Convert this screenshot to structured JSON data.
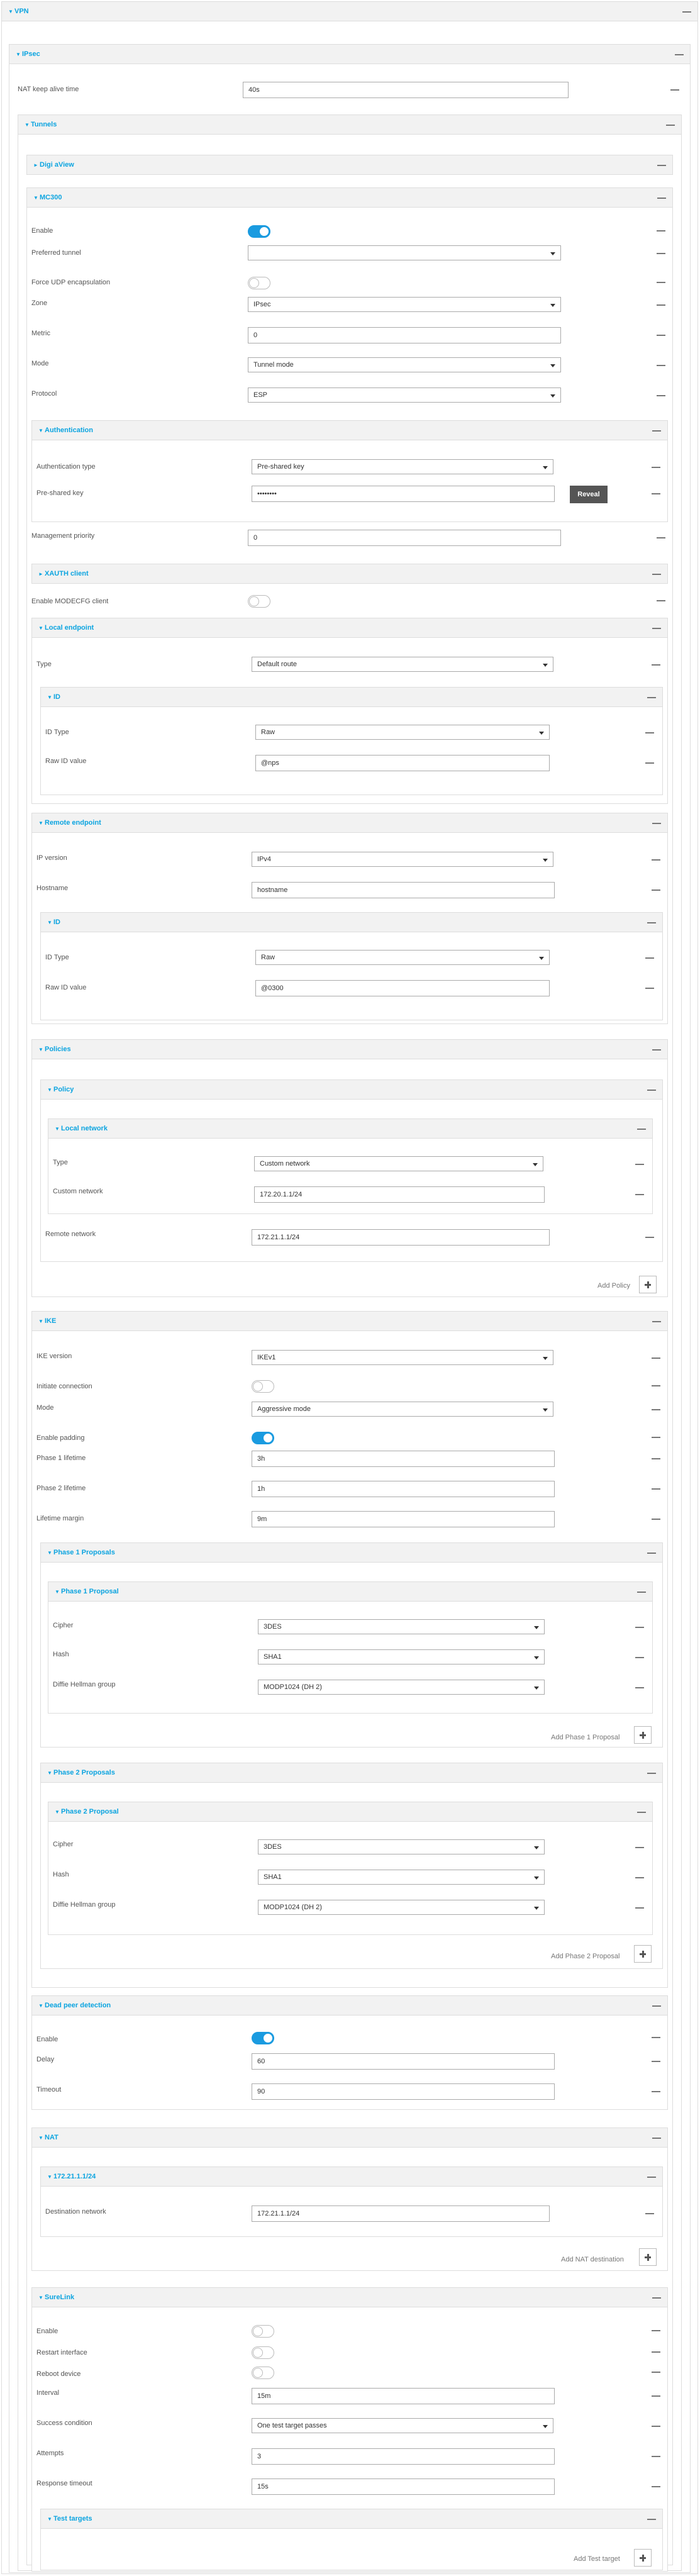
{
  "vpn": {
    "title": "VPN"
  },
  "ipsec": {
    "title": "IPsec",
    "nat_keepalive_label": "NAT keep alive time",
    "nat_keepalive_value": "40s"
  },
  "tunnels": {
    "title": "Tunnels",
    "digi_aview": "Digi aView",
    "tunnel_name": "MC300"
  },
  "tunnel": {
    "enable": "Enable",
    "preferred_tunnel": "Preferred tunnel",
    "preferred_tunnel_value": "",
    "force_udp": "Force UDP encapsulation",
    "zone": "Zone",
    "zone_value": "IPsec",
    "metric": "Metric",
    "metric_value": "0",
    "mode": "Mode",
    "mode_value": "Tunnel mode",
    "protocol": "Protocol",
    "protocol_value": "ESP"
  },
  "auth": {
    "title": "Authentication",
    "type_label": "Authentication type",
    "type_value": "Pre-shared key",
    "psk_label": "Pre-shared key",
    "psk_value": "••••••••",
    "reveal": "Reveal"
  },
  "mgmt_priority": {
    "label": "Management priority",
    "value": "0"
  },
  "xauth": {
    "title": "XAUTH client"
  },
  "modecfg": {
    "label": "Enable MODECFG client"
  },
  "local_endpoint": {
    "title": "Local endpoint",
    "type_label": "Type",
    "type_value": "Default route",
    "id_title": "ID",
    "id_type_label": "ID Type",
    "id_type_value": "Raw",
    "raw_id_label": "Raw ID value",
    "raw_id_value": "@nps"
  },
  "remote_endpoint": {
    "title": "Remote endpoint",
    "ip_version_label": "IP version",
    "ip_version_value": "IPv4",
    "hostname_label": "Hostname",
    "hostname_value": "hostname",
    "id_title": "ID",
    "id_type_label": "ID Type",
    "id_type_value": "Raw",
    "raw_id_label": "Raw ID value",
    "raw_id_value": "@0300"
  },
  "policies": {
    "title": "Policies",
    "policy_title": "Policy",
    "local_network_title": "Local network",
    "type_label": "Type",
    "type_value": "Custom network",
    "custom_network_label": "Custom network",
    "custom_network_value": "172.20.1.1/24",
    "remote_network_label": "Remote network",
    "remote_network_value": "172.21.1.1/24",
    "add": "Add Policy"
  },
  "ike": {
    "title": "IKE",
    "version_label": "IKE version",
    "version_value": "IKEv1",
    "initiate_label": "Initiate connection",
    "mode_label": "Mode",
    "mode_value": "Aggressive mode",
    "padding_label": "Enable padding",
    "p1life_label": "Phase 1 lifetime",
    "p1life_value": "3h",
    "p2life_label": "Phase 2 lifetime",
    "p2life_value": "1h",
    "margin_label": "Lifetime margin",
    "margin_value": "9m"
  },
  "phase1": {
    "title": "Phase 1 Proposals",
    "proposal_title": "Phase 1 Proposal",
    "cipher_label": "Cipher",
    "cipher_value": "3DES",
    "hash_label": "Hash",
    "hash_value": "SHA1",
    "dh_label": "Diffie Hellman group",
    "dh_value": "MODP1024 (DH 2)",
    "add": "Add Phase 1 Proposal"
  },
  "phase2": {
    "title": "Phase 2 Proposals",
    "proposal_title": "Phase 2 Proposal",
    "cipher_label": "Cipher",
    "cipher_value": "3DES",
    "hash_label": "Hash",
    "hash_value": "SHA1",
    "dh_label": "Diffie Hellman group",
    "dh_value": "MODP1024 (DH 2)",
    "add": "Add Phase 2 Proposal"
  },
  "dpd": {
    "title": "Dead peer detection",
    "enable_label": "Enable",
    "delay_label": "Delay",
    "delay_value": "60",
    "timeout_label": "Timeout",
    "timeout_value": "90"
  },
  "nat": {
    "title": "NAT",
    "entry_title": "172.21.1.1/24",
    "dest_label": "Destination network",
    "dest_value": "172.21.1.1/24",
    "add": "Add NAT destination"
  },
  "surelink": {
    "title": "SureLink",
    "enable_label": "Enable",
    "restart_label": "Restart interface",
    "reboot_label": "Reboot device",
    "interval_label": "Interval",
    "interval_value": "15m",
    "success_label": "Success condition",
    "success_value": "One test target passes",
    "attempts_label": "Attempts",
    "attempts_value": "3",
    "resp_label": "Response timeout",
    "resp_value": "15s",
    "targets_title": "Test targets",
    "add": "Add Test target"
  },
  "colors": {
    "accent": "#0ba4e0",
    "toggle_on": "#1a9be0"
  }
}
